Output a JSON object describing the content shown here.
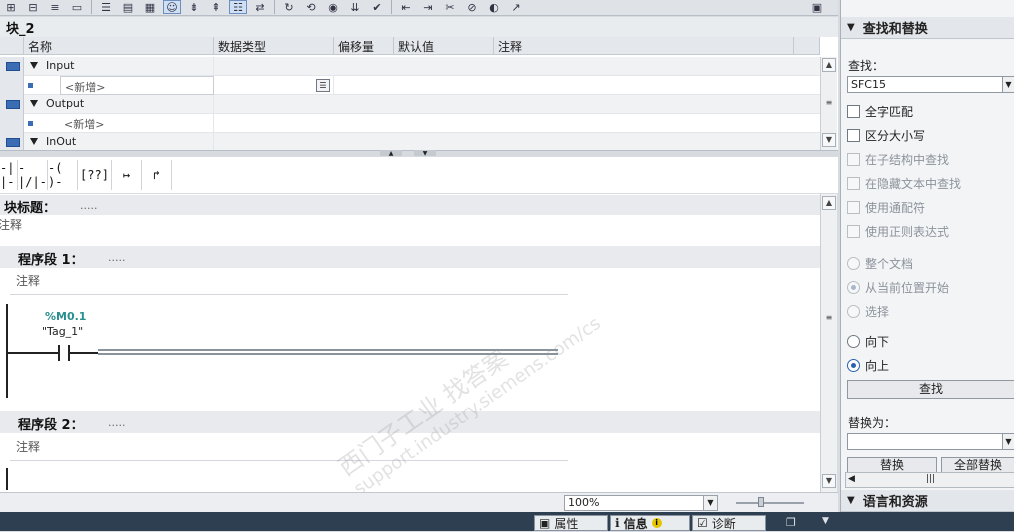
{
  "block": {
    "title": "块_2"
  },
  "interface": {
    "columns": [
      "名称",
      "数据类型",
      "偏移量",
      "默认值",
      "注释"
    ],
    "rows": [
      {
        "kind": "section",
        "name": "Input"
      },
      {
        "kind": "new",
        "name": "<新增>"
      },
      {
        "kind": "section",
        "name": "Output"
      },
      {
        "kind": "new",
        "name": "<新增>"
      },
      {
        "kind": "section",
        "name": "InOut"
      }
    ]
  },
  "ladder_toolbar": {
    "contact_no": "-| |-",
    "contact_nc": "-|/|-",
    "coil": "-( )-",
    "box": "[??]",
    "branch_open": "↦",
    "branch_close": "↱"
  },
  "editor": {
    "block_title_label": "块标题：",
    "block_title_dots": ".....",
    "block_comment": "注释",
    "networks": [
      {
        "label": "程序段 1：",
        "dots": ".....",
        "comment": "注释",
        "operand_address": "%M0.1",
        "operand_tag": "\"Tag_1\""
      },
      {
        "label": "程序段 2：",
        "dots": ".....",
        "comment": "注释"
      }
    ]
  },
  "status": {
    "zoom": "100%"
  },
  "bottom_tabs": {
    "properties": "属性",
    "info": "信息",
    "diagnostics": "诊断"
  },
  "find_replace": {
    "header": "查找和替换",
    "find_label": "查找：",
    "find_value": "SFC15",
    "options": [
      {
        "label": "全字匹配",
        "checked": false,
        "enabled": true
      },
      {
        "label": "区分大小写",
        "checked": false,
        "enabled": true
      },
      {
        "label": "在子结构中查找",
        "checked": false,
        "enabled": false
      },
      {
        "label": "在隐藏文本中查找",
        "checked": false,
        "enabled": false
      },
      {
        "label": "使用通配符",
        "checked": false,
        "enabled": false
      },
      {
        "label": "使用正则表达式",
        "checked": false,
        "enabled": false
      }
    ],
    "scope": [
      {
        "label": "整个文档",
        "selected": false,
        "enabled": false
      },
      {
        "label": "从当前位置开始",
        "selected": true,
        "enabled": false
      },
      {
        "label": "选择",
        "selected": false,
        "enabled": false
      }
    ],
    "direction": [
      {
        "label": "向下",
        "selected": false
      },
      {
        "label": "向上",
        "selected": true
      }
    ],
    "find_button": "查找",
    "replace_label": "替换为：",
    "replace_value": "",
    "replace_button": "替换",
    "replace_all_button": "全部替换"
  },
  "lang_resources": {
    "header": "语言和资源"
  },
  "watermark": {
    "line1": "西门子工业   找答案",
    "line2": "support.industry.siemens.com/cs"
  }
}
